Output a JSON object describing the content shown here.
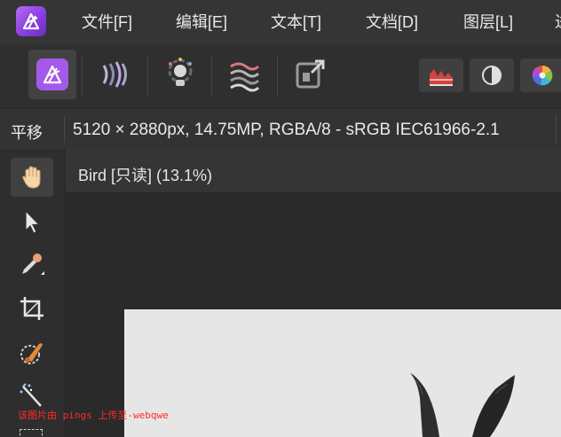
{
  "app": {
    "name": "Affinity Photo",
    "logo_icon": "affinity-photo-logo-icon"
  },
  "menu": [
    {
      "label": "文件[F]"
    },
    {
      "label": "编辑[E]"
    },
    {
      "label": "文本[T]"
    },
    {
      "label": "文档[D]"
    },
    {
      "label": "图层[L]"
    }
  ],
  "personas": [
    {
      "icon": "photo-persona-icon",
      "active": true
    },
    {
      "icon": "liquify-persona-icon",
      "active": false
    },
    {
      "icon": "develop-persona-icon",
      "active": false
    },
    {
      "icon": "tone-mapping-persona-icon",
      "active": false
    },
    {
      "icon": "export-persona-icon",
      "active": false
    }
  ],
  "studio_buttons": [
    {
      "icon": "histogram-icon"
    },
    {
      "icon": "adjustments-icon"
    },
    {
      "icon": "color-wheel-icon"
    }
  ],
  "context": {
    "tool_name": "平移",
    "doc_info": "5120 × 2880px, 14.75MP, RGBA/8 - sRGB IEC61966-2.1"
  },
  "tools": [
    {
      "icon": "hand-tool-icon",
      "active": true
    },
    {
      "icon": "move-tool-icon",
      "active": false
    },
    {
      "icon": "color-picker-icon",
      "active": false
    },
    {
      "icon": "crop-tool-icon",
      "active": false
    },
    {
      "icon": "selection-brush-icon",
      "active": false
    },
    {
      "icon": "magic-wand-icon",
      "active": false
    }
  ],
  "document": {
    "tab_title": "Bird [只读] (13.1%)"
  },
  "watermark": {
    "text": "该图片由 pings 上传至-webqwe"
  },
  "colors": {
    "accent": "#9b4dea",
    "menubar": "#353535",
    "canvas": "#e6e6e6",
    "watermark": "#ff2a2a"
  }
}
